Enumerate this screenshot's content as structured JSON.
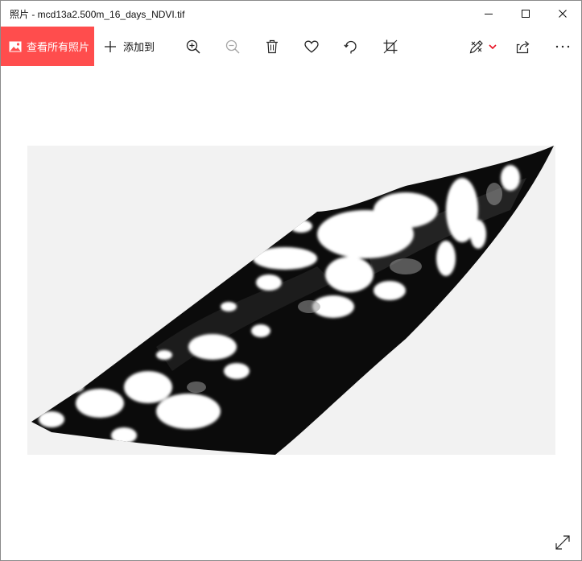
{
  "window": {
    "title": "照片 - mcd13a2.500m_16_days_NDVI.tif",
    "controls": [
      "minimize-icon",
      "maximize-icon",
      "close-icon"
    ]
  },
  "toolbar": {
    "view_all_label": "查看所有照片",
    "add_to_label": "添加到",
    "icons": [
      "zoom-in-icon",
      "zoom-out-icon",
      "delete-icon",
      "favorite-icon",
      "rotate-icon",
      "crop-icon",
      "edit-create-icon",
      "chevron-down-icon",
      "share-icon",
      "more-icon"
    ],
    "accent_color": "#ff4d4d",
    "zoom_out_disabled": true
  },
  "viewer": {
    "image_background": "#f2f2f2",
    "image_content": "black-and-white NDVI raster swath",
    "fullscreen_icon": "expand-diagonal-icon"
  }
}
